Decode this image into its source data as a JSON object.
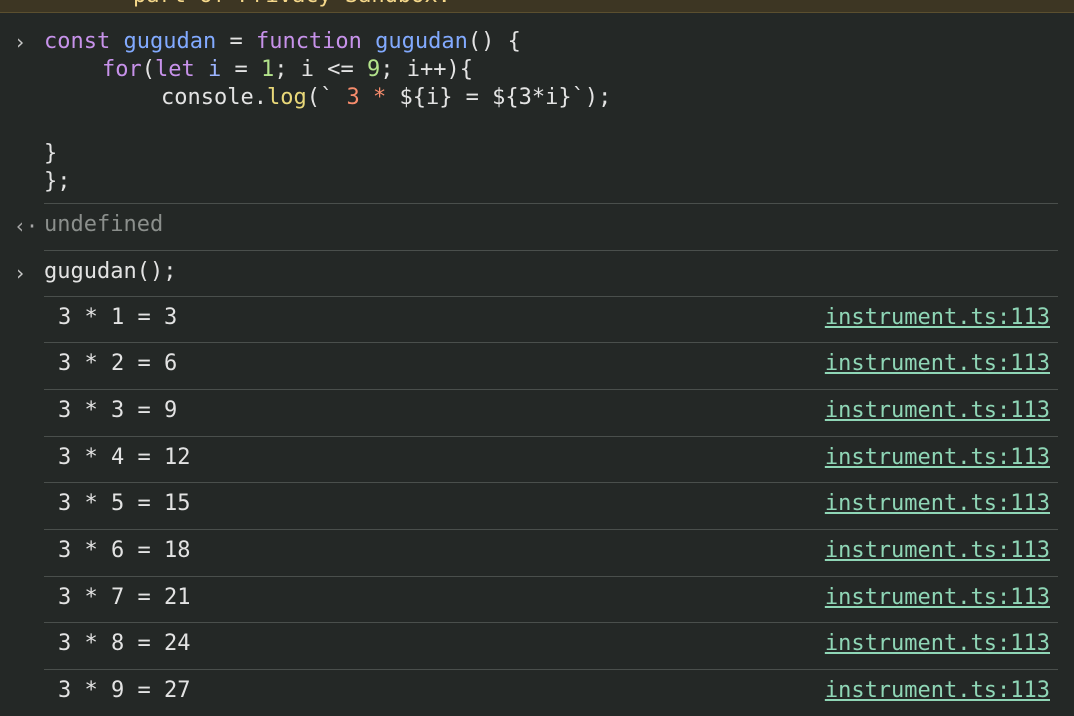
{
  "banner": {
    "text": "part of Privacy Sandbox."
  },
  "input_block": {
    "prompt_symbol": "›",
    "line1": {
      "kw": "const",
      "name": "gugudan",
      "eq": "=",
      "kw2": "function",
      "name2": "gugudan",
      "rest": "() {"
    },
    "line2": {
      "kw": "for",
      "open": "(",
      "kw2": "let",
      "var": "i",
      "mid1": "=",
      "num1": "1",
      "mid2": "; i <=",
      "num2": "9",
      "rest": "; i++){"
    },
    "line3": {
      "obj": "console.",
      "fn": "log",
      "open": "(`",
      "tmpl": " 3 * ",
      "rest": "${i} = ${3*i}`);"
    },
    "line4": "",
    "line5": "}",
    "line6": "};"
  },
  "result1": {
    "symbol": "‹·",
    "text": "undefined"
  },
  "input2": {
    "prompt_symbol": "›",
    "code": "gugudan();"
  },
  "logs": [
    {
      "msg": "3 * 1 = 3",
      "src": "instrument.ts:113"
    },
    {
      "msg": "3 * 2 = 6",
      "src": "instrument.ts:113"
    },
    {
      "msg": "3 * 3 = 9",
      "src": "instrument.ts:113"
    },
    {
      "msg": "3 * 4 = 12",
      "src": "instrument.ts:113"
    },
    {
      "msg": "3 * 5 = 15",
      "src": "instrument.ts:113"
    },
    {
      "msg": "3 * 6 = 18",
      "src": "instrument.ts:113"
    },
    {
      "msg": "3 * 7 = 21",
      "src": "instrument.ts:113"
    },
    {
      "msg": "3 * 8 = 24",
      "src": "instrument.ts:113"
    },
    {
      "msg": "3 * 9 = 27",
      "src": "instrument.ts:113"
    }
  ]
}
